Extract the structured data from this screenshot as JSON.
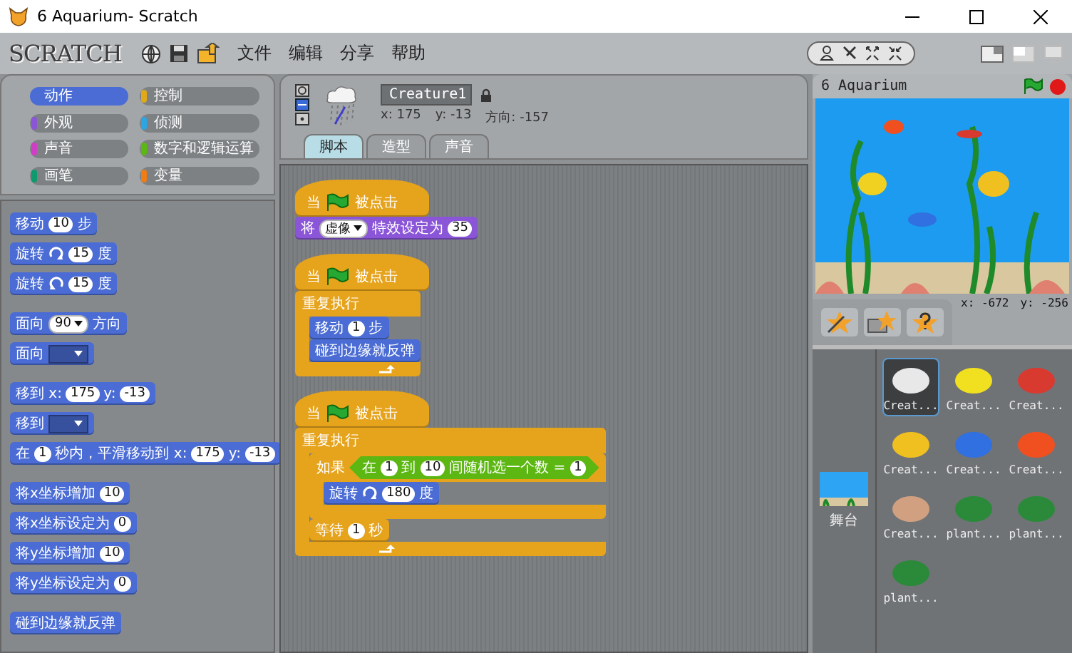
{
  "window": {
    "title": "6 Aquarium- Scratch"
  },
  "logo": "SCRATCH",
  "menu": [
    "文件",
    "编辑",
    "分享",
    "帮助"
  ],
  "categories": [
    {
      "label": "动作",
      "color": "#4a6cd4",
      "selected": true
    },
    {
      "label": "控制",
      "color": "#e1a91a",
      "selected": false
    },
    {
      "label": "外观",
      "color": "#8a55d7",
      "selected": false
    },
    {
      "label": "侦测",
      "color": "#2ca5e2",
      "selected": false
    },
    {
      "label": "声音",
      "color": "#cf3fc6",
      "selected": false
    },
    {
      "label": "数字和逻辑运算",
      "color": "#5cb712",
      "selected": false
    },
    {
      "label": "画笔",
      "color": "#0e9a6c",
      "selected": false
    },
    {
      "label": "变量",
      "color": "#ee7d16",
      "selected": false
    }
  ],
  "palette": [
    [
      {
        "kind": "command",
        "color": "#4a6cd4",
        "parts": [
          {
            "kind": "text",
            "text": "移动"
          },
          {
            "kind": "num",
            "text": "10"
          },
          {
            "kind": "text",
            "text": "步"
          }
        ]
      },
      {
        "kind": "command",
        "color": "#4a6cd4",
        "parts": [
          {
            "kind": "text",
            "text": "旋转"
          },
          {
            "kind": "cw"
          },
          {
            "kind": "num",
            "text": "15"
          },
          {
            "kind": "text",
            "text": "度"
          }
        ]
      },
      {
        "kind": "command",
        "color": "#4a6cd4",
        "parts": [
          {
            "kind": "text",
            "text": "旋转"
          },
          {
            "kind": "ccw"
          },
          {
            "kind": "num",
            "text": "15"
          },
          {
            "kind": "text",
            "text": "度"
          }
        ]
      }
    ],
    [
      {
        "kind": "command",
        "color": "#4a6cd4",
        "parts": [
          {
            "kind": "text",
            "text": "面向"
          },
          {
            "kind": "drop",
            "text": "90"
          },
          {
            "kind": "text",
            "text": "方向"
          }
        ]
      },
      {
        "kind": "command",
        "color": "#4a6cd4",
        "parts": [
          {
            "kind": "text",
            "text": "面向"
          },
          {
            "kind": "drop"
          }
        ]
      }
    ],
    [
      {
        "kind": "command",
        "color": "#4a6cd4",
        "parts": [
          {
            "kind": "text",
            "text": "移到 x:"
          },
          {
            "kind": "num",
            "text": "175"
          },
          {
            "kind": "text",
            "text": "y:"
          },
          {
            "kind": "num",
            "text": "-13"
          }
        ]
      },
      {
        "kind": "command",
        "color": "#4a6cd4",
        "parts": [
          {
            "kind": "text",
            "text": "移到"
          },
          {
            "kind": "drop"
          }
        ]
      },
      {
        "kind": "command",
        "color": "#4a6cd4",
        "parts": [
          {
            "kind": "text",
            "text": "在"
          },
          {
            "kind": "num",
            "text": "1"
          },
          {
            "kind": "text",
            "text": "秒内，平滑移动到 x:"
          },
          {
            "kind": "num",
            "text": "175"
          },
          {
            "kind": "text",
            "text": "y:"
          },
          {
            "kind": "num",
            "text": "-13"
          }
        ]
      }
    ],
    [
      {
        "kind": "command",
        "color": "#4a6cd4",
        "parts": [
          {
            "kind": "text",
            "text": "将x坐标增加"
          },
          {
            "kind": "num",
            "text": "10"
          }
        ]
      },
      {
        "kind": "command",
        "color": "#4a6cd4",
        "parts": [
          {
            "kind": "text",
            "text": "将x坐标设定为"
          },
          {
            "kind": "num",
            "text": "0"
          }
        ]
      },
      {
        "kind": "command",
        "color": "#4a6cd4",
        "parts": [
          {
            "kind": "text",
            "text": "将y坐标增加"
          },
          {
            "kind": "num",
            "text": "10"
          }
        ]
      },
      {
        "kind": "command",
        "color": "#4a6cd4",
        "parts": [
          {
            "kind": "text",
            "text": "将y坐标设定为"
          },
          {
            "kind": "num",
            "text": "0"
          }
        ]
      }
    ],
    [
      {
        "kind": "command",
        "color": "#4a6cd4",
        "parts": [
          {
            "kind": "text",
            "text": "碰到边缘就反弹"
          }
        ]
      }
    ]
  ],
  "sprite": {
    "name": "Creature1",
    "x": "x: 175",
    "y": "y: -13",
    "direction": "方向: -157"
  },
  "tabs": [
    {
      "label": "脚本",
      "selected": true
    },
    {
      "label": "造型",
      "selected": false
    },
    {
      "label": "声音",
      "selected": false
    }
  ],
  "scripts": [
    [
      {
        "kind": "hat",
        "color": "#e6a31c",
        "parts": [
          {
            "kind": "text",
            "text": "当"
          },
          {
            "kind": "flag"
          },
          {
            "kind": "text",
            "text": "被点击"
          }
        ]
      },
      {
        "kind": "command",
        "color": "#8a55d7",
        "parts": [
          {
            "kind": "text",
            "text": "将"
          },
          {
            "kind": "drop",
            "text": "虚像"
          },
          {
            "kind": "text",
            "text": "特效设定为"
          },
          {
            "kind": "num",
            "text": "35"
          }
        ]
      }
    ],
    [
      {
        "kind": "hat",
        "color": "#e6a31c",
        "parts": [
          {
            "kind": "text",
            "text": "当"
          },
          {
            "kind": "flag"
          },
          {
            "kind": "text",
            "text": "被点击"
          }
        ]
      },
      {
        "kind": "c",
        "color": "#e6a31c",
        "loop": true,
        "parts": [
          {
            "kind": "text",
            "text": "重复执行"
          }
        ],
        "children": [
          {
            "kind": "command",
            "color": "#4a6cd4",
            "parts": [
              {
                "kind": "text",
                "text": "移动"
              },
              {
                "kind": "num",
                "text": "1"
              },
              {
                "kind": "text",
                "text": "步"
              }
            ]
          },
          {
            "kind": "command",
            "color": "#4a6cd4",
            "parts": [
              {
                "kind": "text",
                "text": "碰到边缘就反弹"
              }
            ]
          }
        ]
      }
    ],
    [
      {
        "kind": "hat",
        "color": "#e6a31c",
        "parts": [
          {
            "kind": "text",
            "text": "当"
          },
          {
            "kind": "flag"
          },
          {
            "kind": "text",
            "text": "被点击"
          }
        ]
      },
      {
        "kind": "c",
        "color": "#e6a31c",
        "loop": true,
        "parts": [
          {
            "kind": "text",
            "text": "重复执行"
          }
        ],
        "children": [
          {
            "kind": "c",
            "color": "#e6a31c",
            "loop": false,
            "parts": [
              {
                "kind": "text",
                "text": "如果"
              },
              {
                "kind": "bool",
                "color": "#5cb712",
                "parts": [
                  {
                    "kind": "text",
                    "text": "在"
                  },
                  {
                    "kind": "num",
                    "text": "1"
                  },
                  {
                    "kind": "text",
                    "text": "到"
                  },
                  {
                    "kind": "num",
                    "text": "10"
                  },
                  {
                    "kind": "text",
                    "text": "间随机选一个数"
                  },
                  {
                    "kind": "text",
                    "text": "="
                  },
                  {
                    "kind": "num",
                    "text": "1"
                  }
                ]
              }
            ],
            "children": [
              {
                "kind": "command",
                "color": "#4a6cd4",
                "parts": [
                  {
                    "kind": "text",
                    "text": "旋转"
                  },
                  {
                    "kind": "cw"
                  },
                  {
                    "kind": "num",
                    "text": "180"
                  },
                  {
                    "kind": "text",
                    "text": "度"
                  }
                ]
              }
            ]
          },
          {
            "kind": "command",
            "color": "#e6a31c",
            "parts": [
              {
                "kind": "text",
                "text": "等待"
              },
              {
                "kind": "num",
                "text": "1"
              },
              {
                "kind": "text",
                "text": "秒"
              }
            ]
          }
        ]
      }
    ]
  ],
  "stage": {
    "title": "6 Aquarium",
    "mouse_x": "x: -672",
    "mouse_y": "y: -256",
    "thumbnail_label": "舞台"
  },
  "sprites": [
    {
      "name": "Creat...",
      "color": "#e8e8e8",
      "selected": true
    },
    {
      "name": "Creat...",
      "color": "#f0e020",
      "selected": false
    },
    {
      "name": "Creat...",
      "color": "#d83a30",
      "selected": false
    },
    {
      "name": "Creat...",
      "color": "#f0c020",
      "selected": false
    },
    {
      "name": "Creat...",
      "color": "#3070e0",
      "selected": false
    },
    {
      "name": "Creat...",
      "color": "#f05020",
      "selected": false
    },
    {
      "name": "Creat...",
      "color": "#d0a080",
      "selected": false
    },
    {
      "name": "plant...",
      "color": "#2a8a3a",
      "selected": false
    },
    {
      "name": "plant...",
      "color": "#2a8a3a",
      "selected": false
    },
    {
      "name": "plant...",
      "color": "#2a8a3a",
      "selected": false
    }
  ]
}
